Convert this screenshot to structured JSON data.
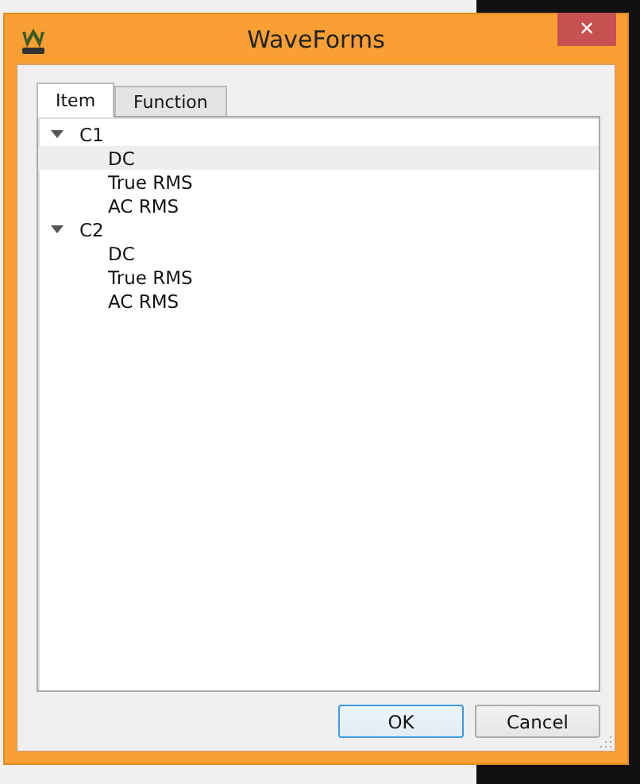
{
  "window": {
    "title": "WaveForms",
    "close": "×"
  },
  "tabs": [
    {
      "label": "Item",
      "selected": true
    },
    {
      "label": "Function",
      "selected": false
    }
  ],
  "tree": [
    {
      "label": "C1",
      "expanded": true,
      "children": [
        {
          "label": "DC",
          "selected": true
        },
        {
          "label": "True RMS",
          "selected": false
        },
        {
          "label": "AC RMS",
          "selected": false
        }
      ]
    },
    {
      "label": "C2",
      "expanded": true,
      "children": [
        {
          "label": "DC",
          "selected": false
        },
        {
          "label": "True RMS",
          "selected": false
        },
        {
          "label": "AC RMS",
          "selected": false
        }
      ]
    }
  ],
  "buttons": [
    {
      "label": "OK",
      "default": true
    },
    {
      "label": "Cancel",
      "default": false
    }
  ]
}
